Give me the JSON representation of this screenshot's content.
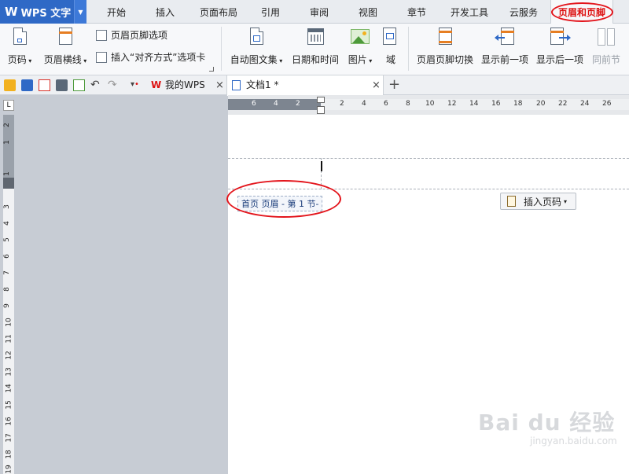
{
  "app": {
    "logo_mark": "W",
    "name": "WPS 文字"
  },
  "menu_tabs": [
    "开始",
    "插入",
    "页面布局",
    "引用",
    "审阅",
    "视图",
    "章节",
    "开发工具",
    "云服务",
    "页眉和页脚"
  ],
  "active_tab": "页眉和页脚",
  "ribbon": {
    "page_number": "页码",
    "header_line": "页眉横线",
    "hf_options": "页眉页脚选项",
    "insert_align_tab": "插入“对齐方式”选项卡",
    "auto_text": "自动图文集",
    "date_time": "日期和时间",
    "picture": "图片",
    "field": "域",
    "hf_switch": "页眉页脚切换",
    "show_prev": "显示前一项",
    "show_next": "显示后一项",
    "same_as_prev": "同前节"
  },
  "doc_tabs": [
    {
      "label": "我的WPS"
    },
    {
      "label": "文档1 *"
    }
  ],
  "hruler_labels": [
    "6",
    "4",
    "2",
    "2",
    "4",
    "6",
    "8",
    "10",
    "12",
    "14",
    "16",
    "18",
    "20",
    "22",
    "24",
    "26"
  ],
  "vruler_labels": [
    "2",
    "1",
    "1",
    "3",
    "4",
    "5",
    "6",
    "7",
    "8",
    "9",
    "10",
    "11",
    "12",
    "13",
    "14",
    "15",
    "16",
    "17",
    "18",
    "19"
  ],
  "ruler_corner": "L",
  "document": {
    "header_label": "首页 页眉 - 第 1 节-",
    "insert_page_number": "插入页码"
  },
  "watermark": {
    "brand": "Bai du 经验",
    "url": "jingyan.baidu.com"
  },
  "colors": {
    "logo_bg": "#2f69c6",
    "active_tab_text": "#dd1111",
    "annotation_red": "#e3141b",
    "accent_orange": "#e67e22"
  }
}
